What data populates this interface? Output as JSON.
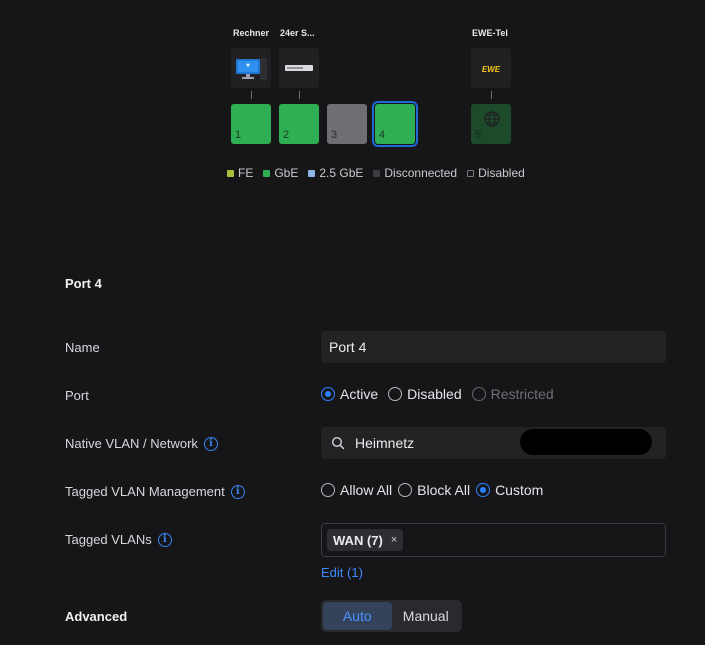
{
  "topology": {
    "devices": [
      {
        "label": "Rechner",
        "icon": "desktop-icon"
      },
      {
        "label": "24er S...",
        "icon": "switch-icon"
      },
      {
        "label": "EWE-Tel",
        "icon": "isp-logo-icon",
        "logo_text": "EWE"
      }
    ],
    "ports": [
      {
        "number": "1",
        "status": "GbE"
      },
      {
        "number": "2",
        "status": "GbE"
      },
      {
        "number": "3",
        "status": "Disconnected"
      },
      {
        "number": "4",
        "status": "GbE",
        "selected": true
      },
      {
        "number": "5",
        "status": "GbE",
        "icon": "globe-icon"
      }
    ],
    "legend": [
      {
        "label": "FE",
        "color": "#a7c23a"
      },
      {
        "label": "GbE",
        "color": "#2eaf53"
      },
      {
        "label": "2.5 GbE",
        "color": "#8fb4e6"
      },
      {
        "label": "Disconnected",
        "color": "#3c3d40"
      },
      {
        "label": "Disabled",
        "color": "#161618"
      }
    ]
  },
  "form": {
    "title": "Port 4",
    "name": {
      "label": "Name",
      "value": "Port 4"
    },
    "port": {
      "label": "Port",
      "options": [
        "Active",
        "Disabled",
        "Restricted"
      ],
      "selected": "Active"
    },
    "native_vlan": {
      "label": "Native VLAN / Network",
      "value": "Heimnetz"
    },
    "tagged_mgmt": {
      "label": "Tagged VLAN Management",
      "options": [
        "Allow All",
        "Block All",
        "Custom"
      ],
      "selected": "Custom"
    },
    "tagged_vlans": {
      "label": "Tagged VLANs",
      "chip": "WAN (7)",
      "chip_remove": "×",
      "edit_link": "Edit (1)"
    },
    "advanced": {
      "label": "Advanced",
      "options": [
        "Auto",
        "Manual"
      ],
      "selected": "Auto"
    }
  },
  "colors": {
    "accent": "#2b82ff",
    "port_active": "#2eaf53",
    "port_disconnected": "#6e6f74"
  }
}
